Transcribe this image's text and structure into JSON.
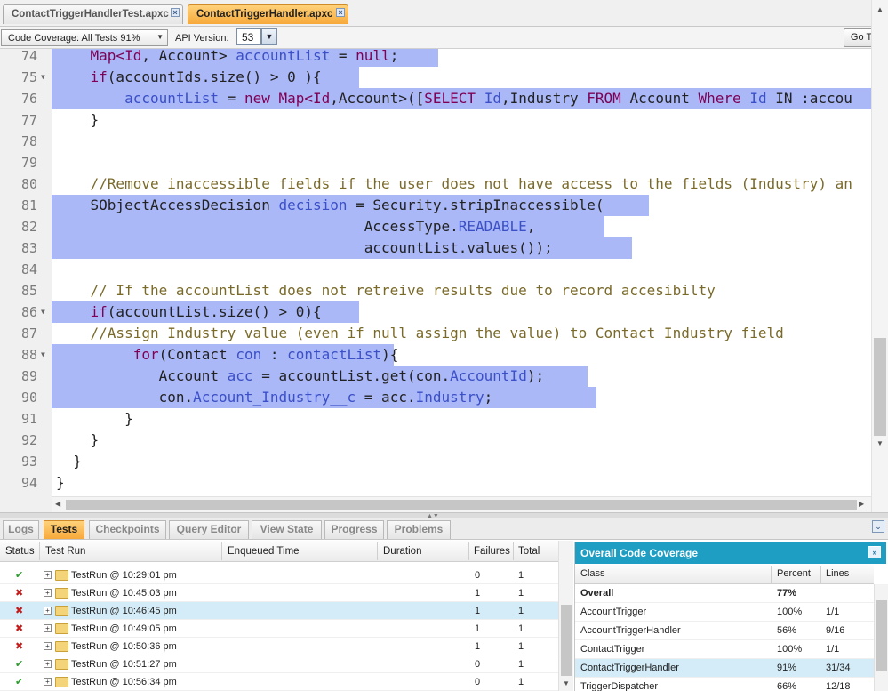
{
  "file_tabs": [
    {
      "label": "ContactTriggerHandlerTest.apxc",
      "active": false
    },
    {
      "label": "ContactTriggerHandler.apxc",
      "active": true
    }
  ],
  "toolbar": {
    "coverage_dropdown": "Code Coverage: All Tests 91%",
    "api_label": "API Version:",
    "api_value": "53",
    "goto_label": "Go To"
  },
  "code_lines": [
    {
      "n": "74",
      "fold": false,
      "hl": 435
    },
    {
      "n": "75",
      "fold": true,
      "hl": 346
    },
    {
      "n": "76",
      "fold": false,
      "hl": 922
    },
    {
      "n": "77",
      "fold": false,
      "hl": 0
    },
    {
      "n": "78",
      "fold": false,
      "hl": 0
    },
    {
      "n": "79",
      "fold": false,
      "hl": 0
    },
    {
      "n": "80",
      "fold": false,
      "hl": 0
    },
    {
      "n": "81",
      "fold": false,
      "hl": 672
    },
    {
      "n": "82",
      "fold": false,
      "hl": 622
    },
    {
      "n": "83",
      "fold": false,
      "hl": 653
    },
    {
      "n": "84",
      "fold": false,
      "hl": 0
    },
    {
      "n": "85",
      "fold": false,
      "hl": 0
    },
    {
      "n": "86",
      "fold": true,
      "hl": 346
    },
    {
      "n": "87",
      "fold": false,
      "hl": 0
    },
    {
      "n": "88",
      "fold": true,
      "hl": 385
    },
    {
      "n": "89",
      "fold": false,
      "hl": 603
    },
    {
      "n": "90",
      "fold": false,
      "hl": 613
    },
    {
      "n": "91",
      "fold": false,
      "hl": 0
    },
    {
      "n": "92",
      "fold": false,
      "hl": 0
    },
    {
      "n": "93",
      "fold": false,
      "hl": 0
    },
    {
      "n": "94",
      "fold": false,
      "hl": 0
    }
  ],
  "code": {
    "l74": {
      "indent": "    ",
      "t1": "Map<",
      "t2": "Id",
      "t3": ", Account> ",
      "t4": "accountList",
      "t5": " = ",
      "t6": "null",
      "t7": ";"
    },
    "l75": {
      "indent": "    ",
      "t1": "if",
      "t2": "(accountIds.size() > ",
      "t3": "0",
      "t4": " ){"
    },
    "l76": {
      "indent": "        ",
      "t1": "accountList",
      "t2": " = ",
      "t3": "new",
      "t4": " ",
      "t5": "Map<",
      "t6": "Id",
      "t7": ",Account>([",
      "t8": "SELECT",
      "t9": " ",
      "t10": "Id",
      "t11": ",Industry ",
      "t12": "FROM",
      "t13": " Account ",
      "t14": "Where",
      "t15": " ",
      "t16": "Id",
      "t17": " IN :accou"
    },
    "l77": {
      "text": "    }"
    },
    "l80": {
      "text": "    //Remove inaccessible fields if the user does not have access to the fields (Industry) an"
    },
    "l81": {
      "indent": "    ",
      "t1": "SObjectAccessDecision ",
      "t2": "decision",
      "t3": " = Security.stripInaccessible("
    },
    "l82": {
      "indent": "                                    ",
      "t1": "AccessType.",
      "t2": "READABLE",
      "t3": ","
    },
    "l83": {
      "text": "                                    accountList.values());"
    },
    "l85": {
      "text": "    // If the accountList does not retreive results due to record accesibilty"
    },
    "l86": {
      "indent": "    ",
      "t1": "if",
      "t2": "(accountList.size() > ",
      "t3": "0",
      "t4": "){"
    },
    "l87": {
      "text": "    //Assign Industry value (even if null assign the value) to Contact Industry field"
    },
    "l88": {
      "indent": "         ",
      "t1": "for",
      "t2": "(Contact ",
      "t3": "con",
      "t4": " : ",
      "t5": "contactList",
      "t6": "){"
    },
    "l89": {
      "indent": "            ",
      "t1": "Account ",
      "t2": "acc",
      "t3": " = accountList.get(con.",
      "t4": "AccountId",
      "t5": ");"
    },
    "l90": {
      "indent": "            ",
      "t1": "con.",
      "t2": "Account_Industry__c",
      "t3": " = acc.",
      "t4": "Industry",
      "t5": ";"
    },
    "l91": {
      "text": "        }"
    },
    "l92": {
      "text": "    }"
    },
    "l93": {
      "text": "  }"
    },
    "l94": {
      "text": "}"
    }
  },
  "bottom_tabs": [
    {
      "label": "Logs",
      "active": false
    },
    {
      "label": "Tests",
      "active": true
    },
    {
      "label": "Checkpoints",
      "active": false
    },
    {
      "label": "Query Editor",
      "active": false
    },
    {
      "label": "View State",
      "active": false
    },
    {
      "label": "Progress",
      "active": false
    },
    {
      "label": "Problems",
      "active": false
    }
  ],
  "test_grid": {
    "headers": [
      "Status",
      "Test Run",
      "Enqueued Time",
      "Duration",
      "Failures",
      "Total"
    ],
    "rows": [
      {
        "status": "pass",
        "name": "TestRun @ 10:29:01 pm",
        "failures": "0",
        "total": "1",
        "selected": false
      },
      {
        "status": "fail",
        "name": "TestRun @ 10:45:03 pm",
        "failures": "1",
        "total": "1",
        "selected": false
      },
      {
        "status": "fail",
        "name": "TestRun @ 10:46:45 pm",
        "failures": "1",
        "total": "1",
        "selected": true
      },
      {
        "status": "fail",
        "name": "TestRun @ 10:49:05 pm",
        "failures": "1",
        "total": "1",
        "selected": false
      },
      {
        "status": "fail",
        "name": "TestRun @ 10:50:36 pm",
        "failures": "1",
        "total": "1",
        "selected": false
      },
      {
        "status": "pass",
        "name": "TestRun @ 10:51:27 pm",
        "failures": "0",
        "total": "1",
        "selected": false
      },
      {
        "status": "pass",
        "name": "TestRun @ 10:56:34 pm",
        "failures": "0",
        "total": "1",
        "selected": false
      }
    ]
  },
  "coverage": {
    "title": "Overall Code Coverage",
    "headers": [
      "Class",
      "Percent",
      "Lines"
    ],
    "rows": [
      {
        "class": "Overall",
        "percent": "77%",
        "lines": "",
        "bold": true,
        "selected": false
      },
      {
        "class": "AccountTrigger",
        "percent": "100%",
        "lines": "1/1",
        "bold": false,
        "selected": false
      },
      {
        "class": "AccountTriggerHandler",
        "percent": "56%",
        "lines": "9/16",
        "bold": false,
        "selected": false
      },
      {
        "class": "ContactTrigger",
        "percent": "100%",
        "lines": "1/1",
        "bold": false,
        "selected": false
      },
      {
        "class": "ContactTriggerHandler",
        "percent": "91%",
        "lines": "31/34",
        "bold": false,
        "selected": true
      },
      {
        "class": "TriggerDispatcher",
        "percent": "66%",
        "lines": "12/18",
        "bold": false,
        "selected": false
      }
    ]
  }
}
